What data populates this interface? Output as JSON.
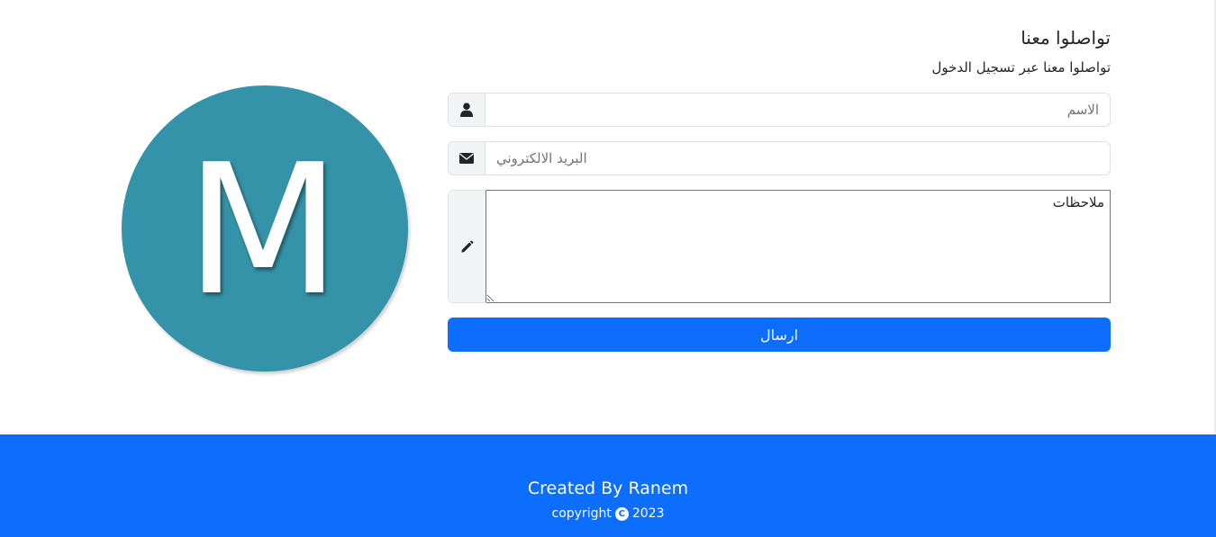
{
  "logo": {
    "letter": "M",
    "bg_color": "#3493a8"
  },
  "contact": {
    "title": "تواصلوا معنا",
    "subtitle": "تواصلوا معنا عبر تسجيل الدخول",
    "name_placeholder": "الاسم",
    "email_placeholder": "البريد الالكتروني",
    "notes_placeholder": "ملاحظات",
    "submit_label": "ارسال",
    "icons": {
      "name": "user-icon",
      "email": "envelope-icon",
      "notes": "pencil-icon"
    }
  },
  "footer": {
    "credit": "Created By Ranem",
    "copyright_prefix": "copyright",
    "copyright_symbol": "C",
    "year": "2023",
    "bg_color": "#0d6efd"
  }
}
